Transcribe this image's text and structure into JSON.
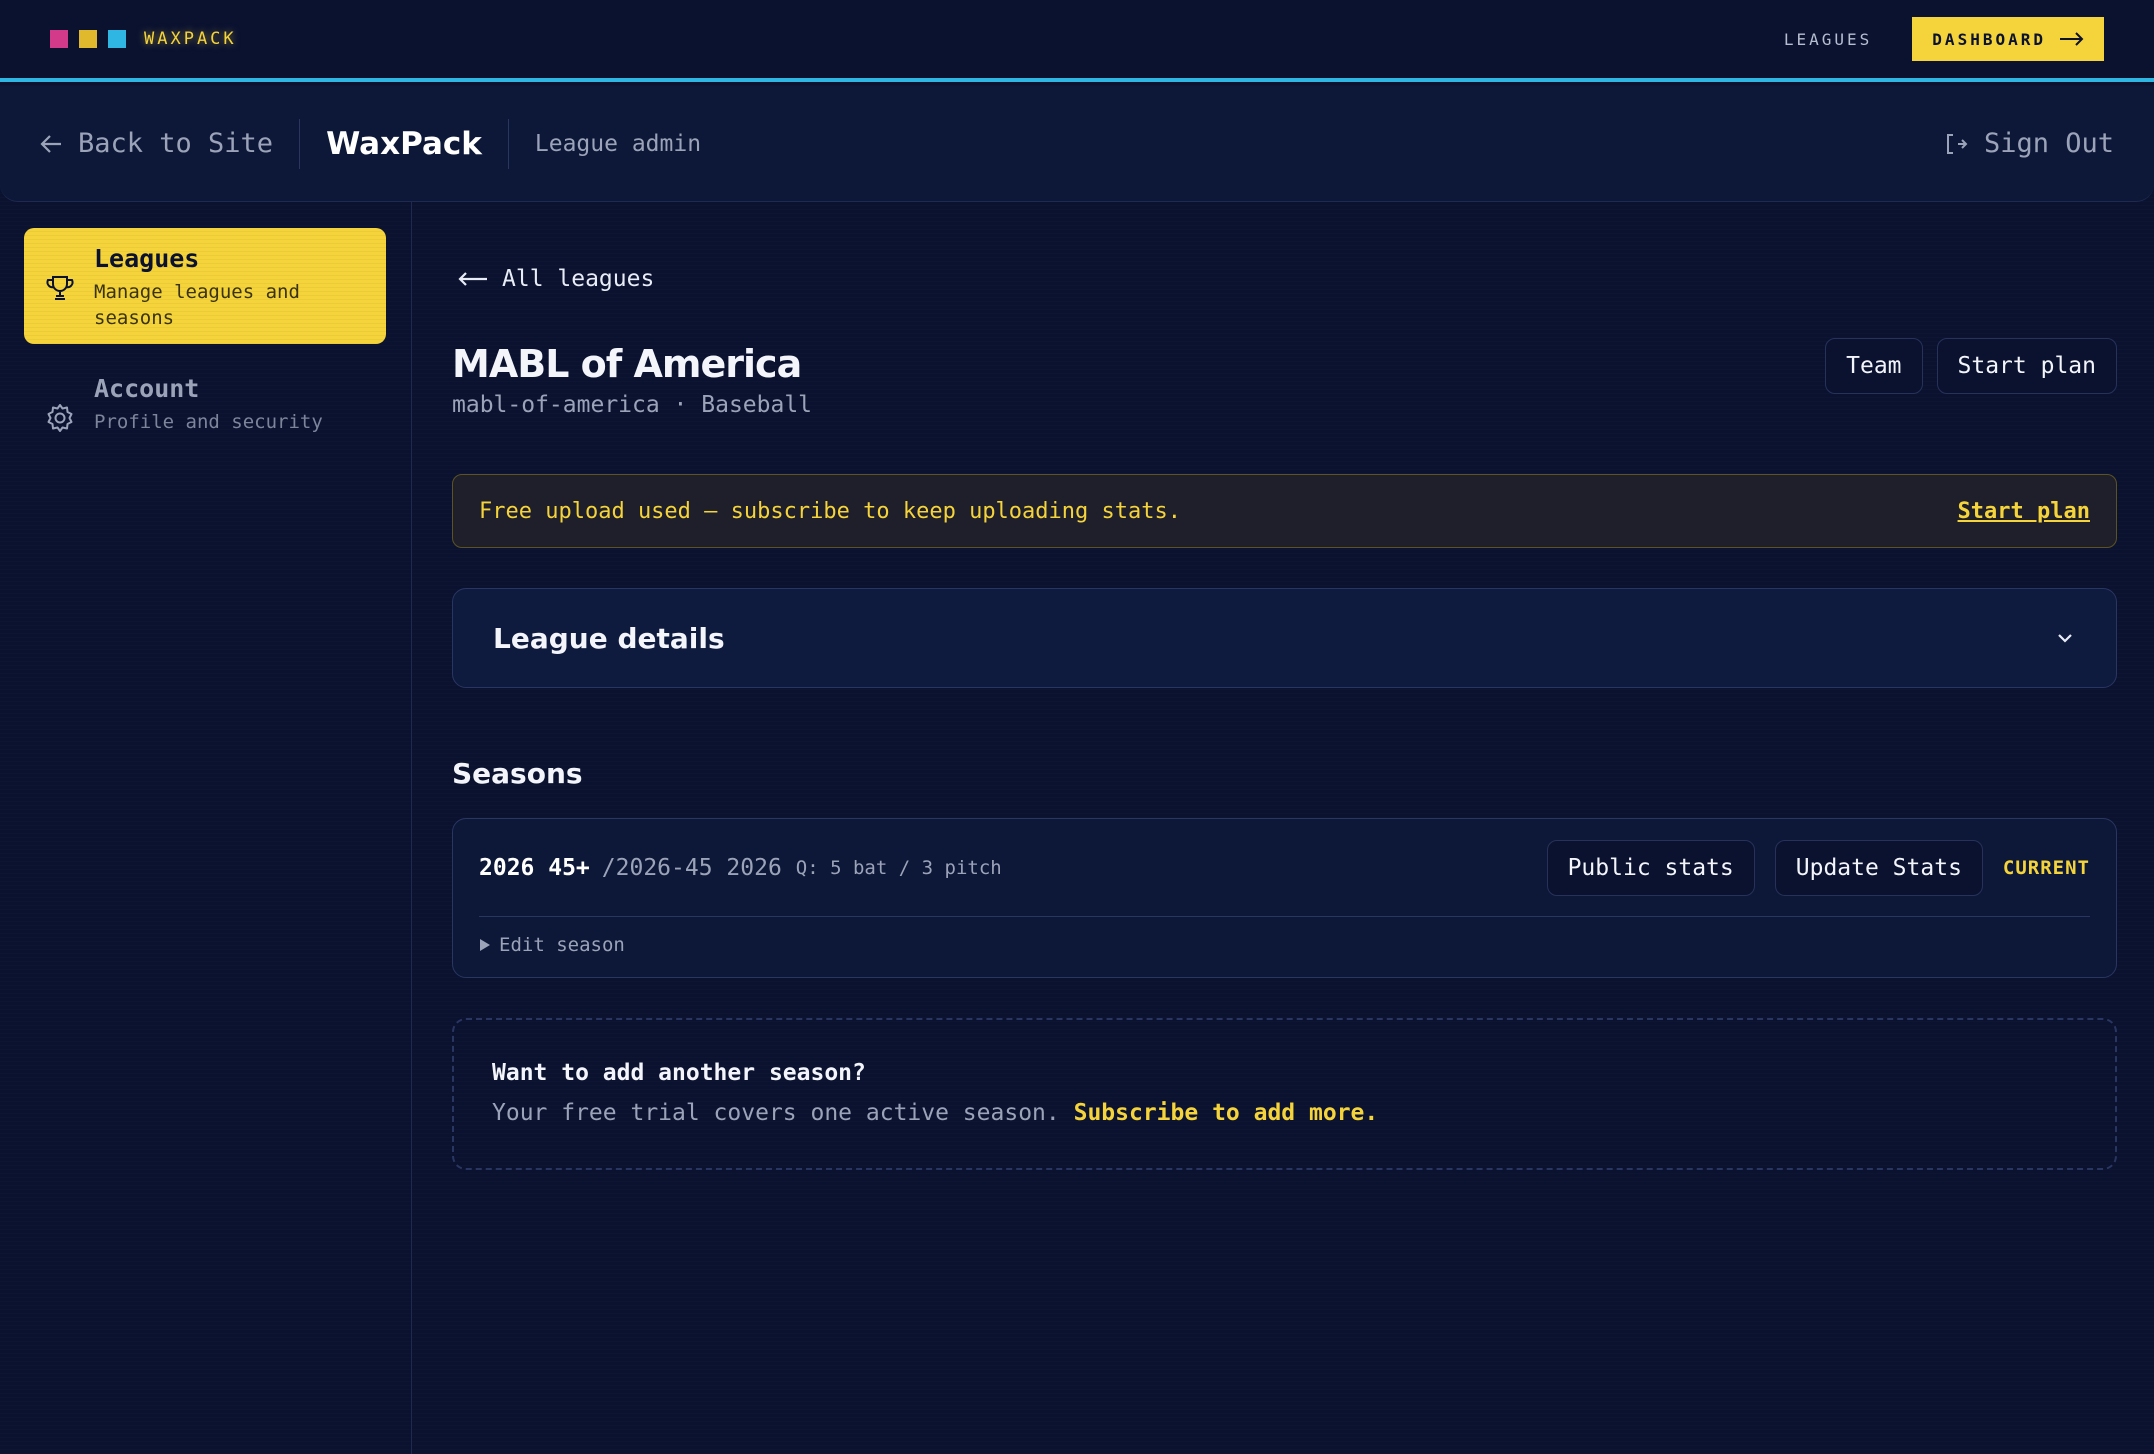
{
  "topbar": {
    "logo_colors": [
      "#d43a8a",
      "#e0b92c",
      "#2fb6e3"
    ],
    "brand": "WAXPACK",
    "leagues_link": "LEAGUES",
    "dashboard_btn": "DASHBOARD"
  },
  "adminbar": {
    "back_label": "Back to Site",
    "brand": "WaxPack",
    "subtitle": "League admin",
    "sign_out": "Sign Out"
  },
  "sidebar": {
    "items": [
      {
        "title": "Leagues",
        "desc": "Manage leagues and seasons",
        "icon": "trophy-icon",
        "active": true
      },
      {
        "title": "Account",
        "desc": "Profile and security",
        "icon": "gear-icon",
        "active": false
      }
    ]
  },
  "main": {
    "back_label": "All leagues",
    "league_name": "MABL of America",
    "league_slug": "mabl-of-america · Baseball",
    "team_btn": "Team",
    "start_plan_btn": "Start plan",
    "notice_text": "Free upload used — subscribe to keep uploading stats.",
    "notice_link": "Start plan",
    "details_title": "League details",
    "seasons_heading": "Seasons",
    "season": {
      "name": "2026 45+",
      "slug": "/2026-45 2026",
      "qualifiers": "Q: 5 bat / 3 pitch",
      "public_stats_btn": "Public stats",
      "update_stats_btn": "Update Stats",
      "badge": "CURRENT",
      "edit_label": "Edit season"
    },
    "add_season": {
      "title": "Want to add another season?",
      "text": "Your free trial covers one active season.",
      "link": "Subscribe to add more."
    }
  },
  "colors": {
    "accent": "#f5d33a",
    "background": "#0a1230",
    "topbar_border": "#2fb6e3"
  }
}
